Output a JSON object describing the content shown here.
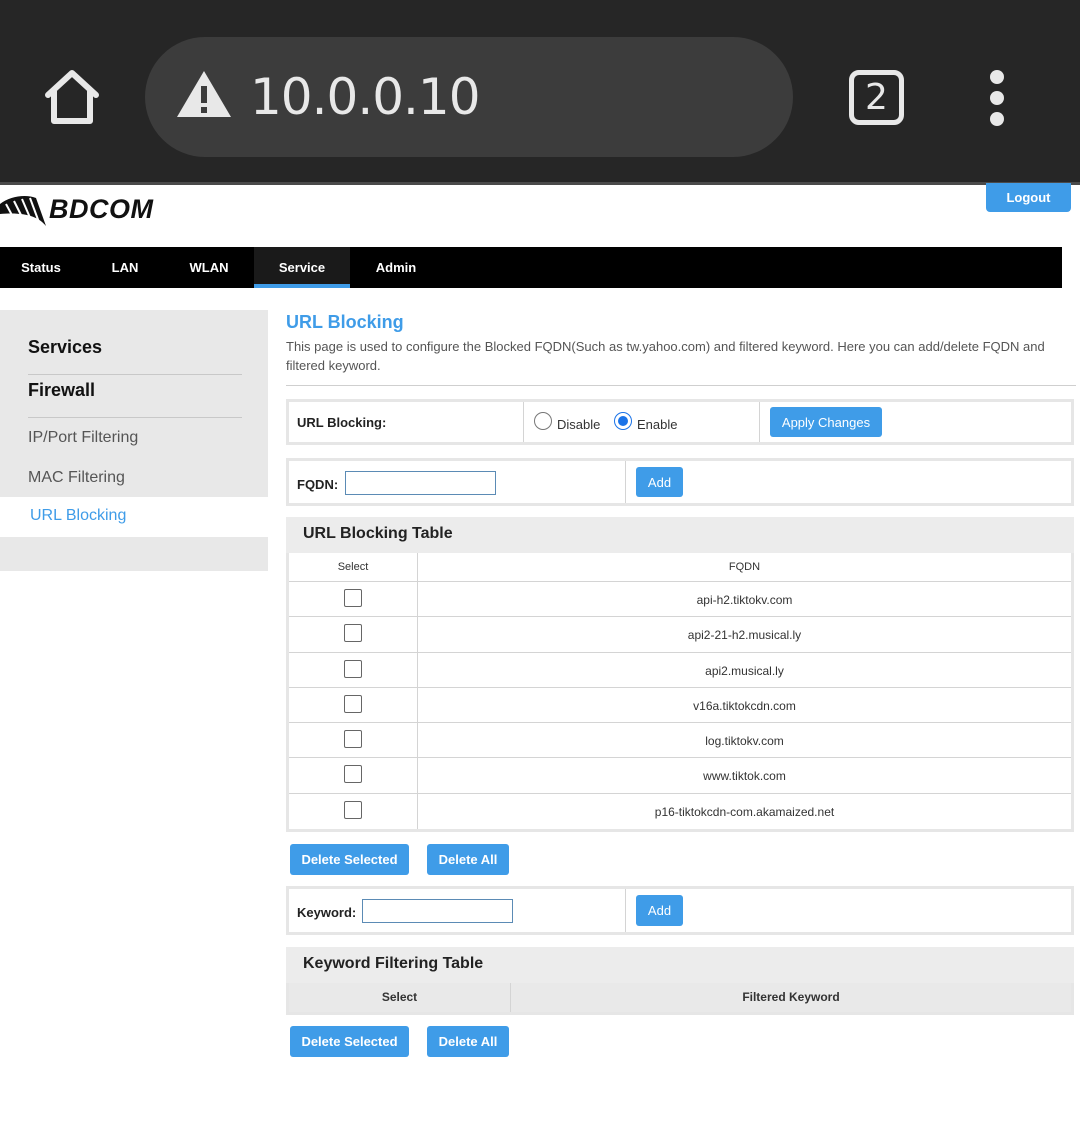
{
  "browser": {
    "url": "10.0.0.10",
    "tab_count": "2"
  },
  "header": {
    "logo_text": "BDCOM",
    "logout_label": "Logout"
  },
  "nav": {
    "items": [
      {
        "label": "Status"
      },
      {
        "label": "LAN"
      },
      {
        "label": "WLAN"
      },
      {
        "label": "Service"
      },
      {
        "label": "Admin"
      }
    ],
    "active": "Service"
  },
  "sidebar": {
    "sections": [
      "Services",
      "Firewall"
    ],
    "items": [
      "IP/Port Filtering",
      "MAC Filtering",
      "URL Blocking"
    ],
    "active": "URL Blocking"
  },
  "main": {
    "title": "URL Blocking",
    "description": "This page is used to configure the Blocked FQDN(Such as tw.yahoo.com) and filtered keyword. Here you can add/delete FQDN and filtered keyword.",
    "url_blocking": {
      "label": "URL Blocking:",
      "disable_label": "Disable",
      "enable_label": "Enable",
      "selected": "Enable",
      "apply_label": "Apply Changes"
    },
    "fqdn": {
      "label": "FQDN:",
      "value": "",
      "add_label": "Add"
    },
    "url_table": {
      "title": "URL Blocking Table",
      "columns": [
        "Select",
        "FQDN"
      ],
      "rows": [
        "api-h2.tiktokv.com",
        "api2-21-h2.musical.ly",
        "api2.musical.ly",
        "v16a.tiktokcdn.com",
        "log.tiktokv.com",
        "www.tiktok.com",
        "p16-tiktokcdn-com.akamaized.net"
      ],
      "delete_selected_label": "Delete Selected",
      "delete_all_label": "Delete All"
    },
    "keyword": {
      "label": "Keyword:",
      "value": "",
      "add_label": "Add"
    },
    "keyword_table": {
      "title": "Keyword Filtering Table",
      "columns": [
        "Select",
        "Filtered Keyword"
      ],
      "rows": [],
      "delete_selected_label": "Delete Selected",
      "delete_all_label": "Delete All"
    }
  },
  "colors": {
    "accent": "#3f9ce8",
    "chrome_bg": "#262626",
    "nav_bg": "#000000",
    "sidebar_bg": "#e8e8e8"
  }
}
